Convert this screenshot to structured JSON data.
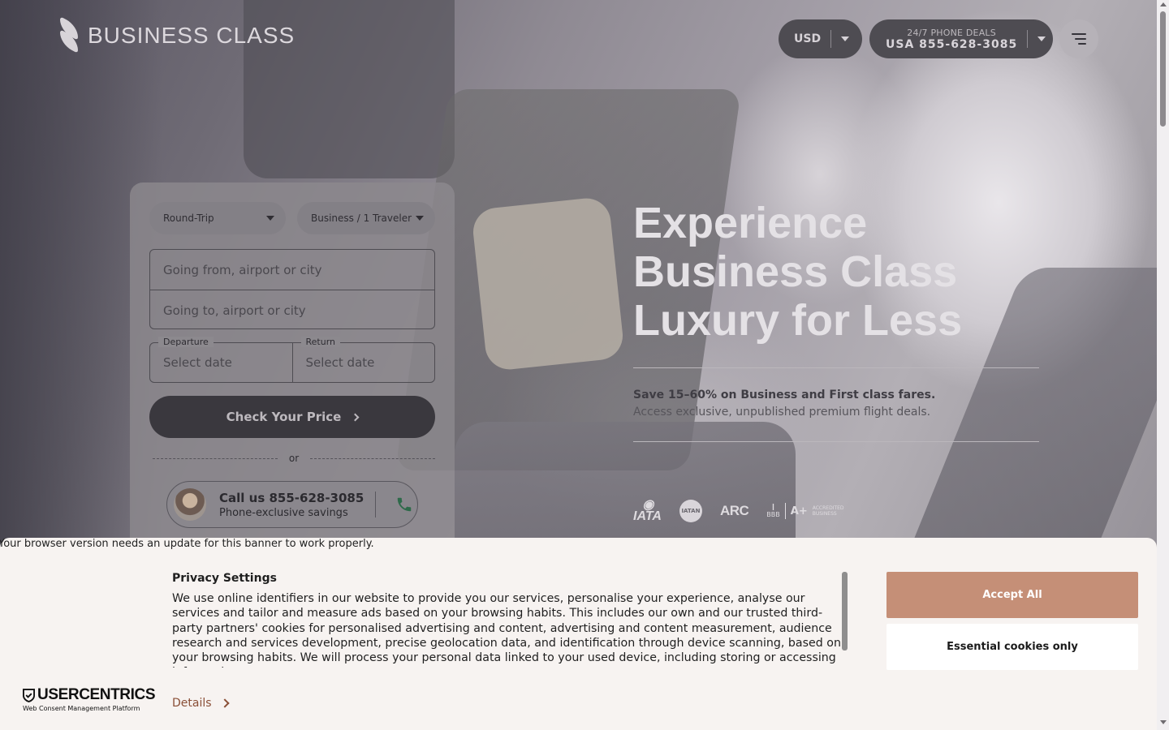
{
  "header": {
    "logo_text": "BUSINESS CLASS",
    "currency": "USD",
    "phone_top": "24/7 PHONE DEALS",
    "phone_number": "USA 855-628-3085",
    "menu_icon": "hamburger-menu-icon"
  },
  "search": {
    "trip_type": "Round-Trip",
    "cabin_travelers": "Business / 1 Traveler",
    "from_placeholder": "Going from, airport or city",
    "to_placeholder": "Going to, airport or city",
    "departure_label": "Departure",
    "departure_value": "Select date",
    "return_label": "Return",
    "return_value": "Select date",
    "cta_label": "Check Your Price",
    "or_label": "or",
    "call_main": "Call us 855-628-3085",
    "call_sub": "Phone-exclusive savings"
  },
  "hero": {
    "title_1": "Experience",
    "title_2": "Business Class",
    "title_3": "Luxury for Less",
    "sub_bold": "Save 15–60% on Business and First class fares.",
    "sub_normal": "Access exclusive, unpublished premium flight deals."
  },
  "badges": {
    "iata": "IATA",
    "iatan": "IATAN",
    "arc": "ARC",
    "bbb": "BBB",
    "bbb_grade": "A+",
    "bbb_acc_1": "ACCREDITED",
    "bbb_acc_2": "BUSINESS"
  },
  "banner": {
    "warning": "Your browser version needs an update for this banner to work properly.",
    "title": "Privacy Settings",
    "body": "We use online identifiers in our website to provide you our services, personalise your experience, analyse our services and tailor and measure ads based on your browsing habits. This includes our own and our trusted third-party partners' cookies for personalised advertising and content, advertising and content measurement, audience research and services development, precise geolocation data, and identification through device scanning, based on your browsing habits. We will process your personal data linked to your used device, including storing or accessing information on your",
    "details": "Details",
    "accept_all": "Accept All",
    "essential_only": "Essential cookies only",
    "brand": "USERCENTRICS",
    "brand_sub": "Web Consent Management Platform"
  },
  "colors": {
    "accept": "#c58f77",
    "details_link": "#8a4f37",
    "banner_bg": "#f7f3f1",
    "cta_bg": "#3a383e"
  }
}
